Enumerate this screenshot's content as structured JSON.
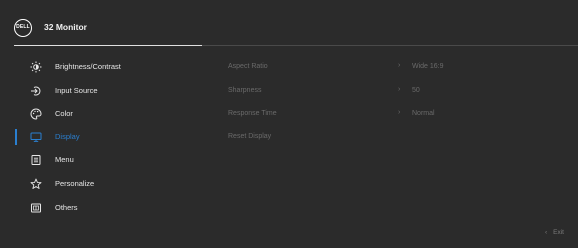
{
  "header": {
    "logo_text": "DELL",
    "title": "32 Monitor"
  },
  "menu": {
    "items": [
      {
        "label": "Brightness/Contrast",
        "icon": "sun-icon"
      },
      {
        "label": "Input Source",
        "icon": "input-arrow-icon"
      },
      {
        "label": "Color",
        "icon": "palette-icon"
      },
      {
        "label": "Display",
        "icon": "monitor-icon",
        "active": true
      },
      {
        "label": "Menu",
        "icon": "menu-list-icon"
      },
      {
        "label": "Personalize",
        "icon": "star-icon"
      },
      {
        "label": "Others",
        "icon": "others-icon"
      }
    ]
  },
  "settings": {
    "rows": [
      {
        "label": "Aspect Ratio",
        "value": "Wide 16:9"
      },
      {
        "label": "Sharpness",
        "value": "50"
      },
      {
        "label": "Response Time",
        "value": "Normal"
      },
      {
        "label": "Reset Display",
        "value": ""
      }
    ]
  },
  "footer": {
    "exit_label": "Exit"
  },
  "colors": {
    "background": "#2b2b2b",
    "accent": "#2a7fd0",
    "text": "#e6e6e6",
    "disabled_text": "#6a6a6a"
  }
}
